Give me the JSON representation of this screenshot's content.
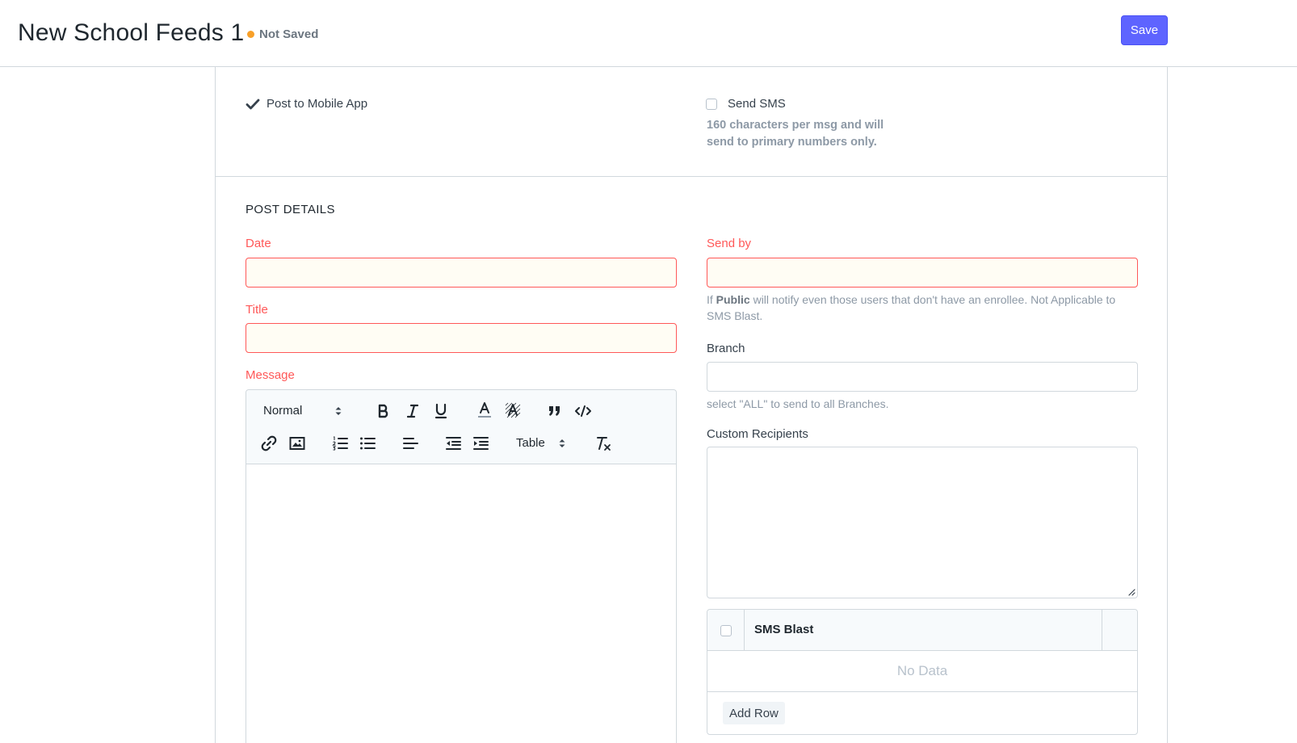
{
  "header": {
    "title": "New School Feeds 1",
    "status": "Not Saved",
    "status_color": "#f8a029",
    "save_label": "Save",
    "accent_color": "#5e64ff"
  },
  "options": {
    "post_to_app_label": "Post to Mobile App",
    "post_to_app_checked": true,
    "send_sms_label": "Send SMS",
    "send_sms_checked": false,
    "sms_note": "160 characters per msg and will send to primary numbers only."
  },
  "post_details": {
    "section_title": "POST DETAILS",
    "date": {
      "label": "Date",
      "value": "",
      "required": true
    },
    "title": {
      "label": "Title",
      "value": "",
      "required": true
    },
    "message": {
      "label": "Message",
      "required": true,
      "toolbar": {
        "header_select": "Normal",
        "table_select": "Table",
        "icons": [
          "bold-icon",
          "italic-icon",
          "underline-icon",
          "font-color-icon",
          "background-color-icon",
          "blockquote-icon",
          "code-block-icon",
          "link-icon",
          "image-icon",
          "ordered-list-icon",
          "bullet-list-icon",
          "align-left-icon",
          "outdent-icon",
          "indent-icon",
          "clear-format-icon"
        ]
      }
    },
    "send_by": {
      "label": "Send by",
      "value": "",
      "required": true,
      "help_prefix": "If ",
      "help_bold": "Public",
      "help_suffix": " will notify even those users that don't have an enrollee. Not Applicable to SMS Blast."
    },
    "branch": {
      "label": "Branch",
      "value": "",
      "help": "select \"ALL\" to send to all Branches."
    },
    "custom_recipients": {
      "label": "Custom Recipients",
      "value": ""
    },
    "sms_blast_table": {
      "column": "SMS Blast",
      "empty_text": "No Data",
      "add_row_label": "Add Row"
    }
  },
  "colors": {
    "required_label": "#ff5858",
    "border": "#d1d8dd",
    "muted_text": "#8d99a6"
  }
}
